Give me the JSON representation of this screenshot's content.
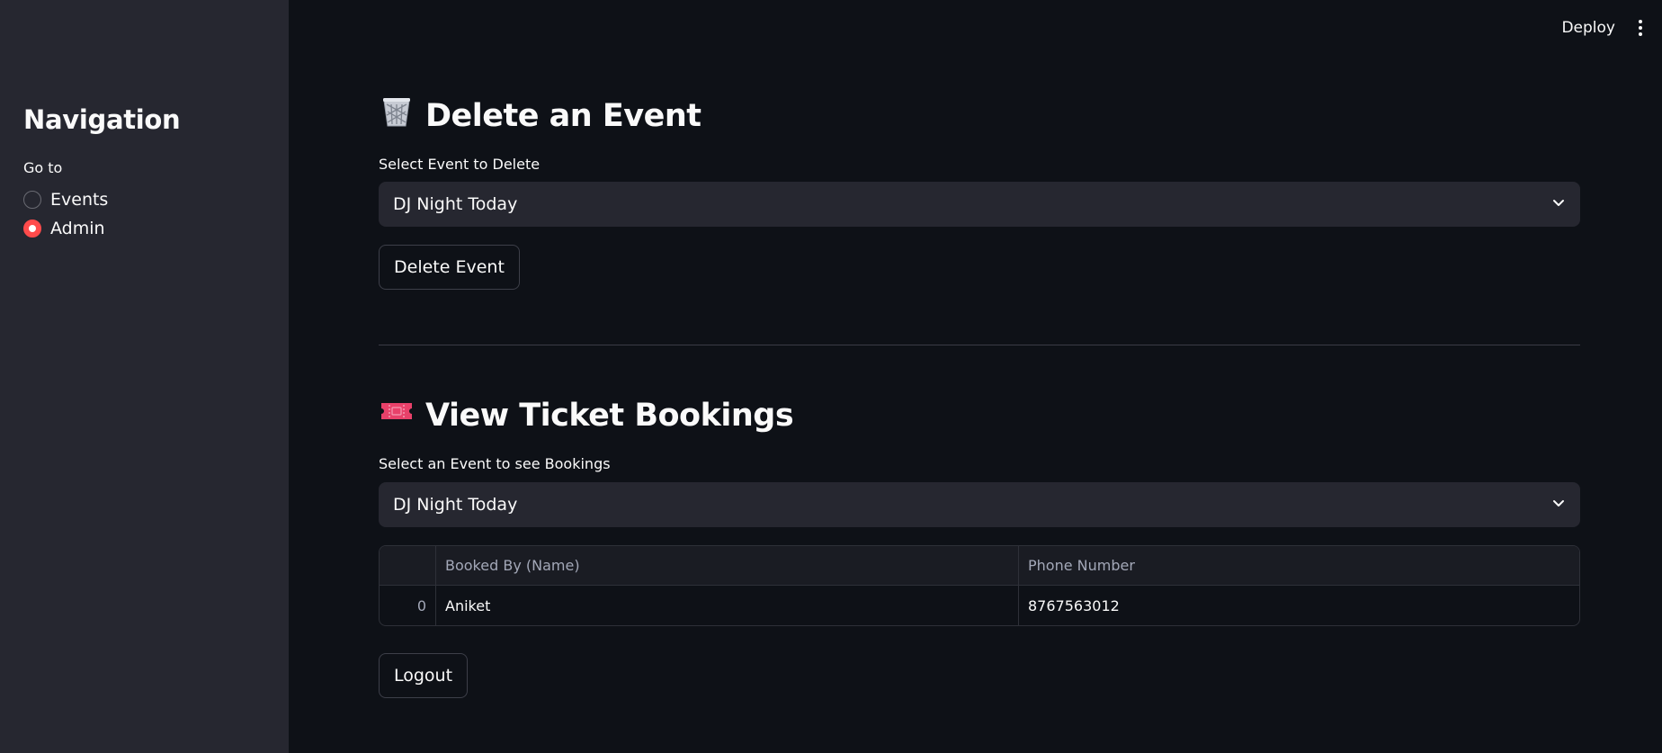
{
  "header": {
    "deploy_label": "Deploy"
  },
  "sidebar": {
    "title": "Navigation",
    "goto_label": "Go to",
    "options": [
      {
        "label": "Events",
        "selected": false
      },
      {
        "label": "Admin",
        "selected": true
      }
    ]
  },
  "delete_section": {
    "icon": "wastebasket-icon",
    "title": "Delete an Event",
    "select_label": "Select Event to Delete",
    "select_value": "DJ Night Today",
    "button_label": "Delete Event"
  },
  "bookings_section": {
    "icon": "ticket-icon",
    "title": "View Ticket Bookings",
    "select_label": "Select an Event to see Bookings",
    "select_value": "DJ Night Today",
    "table": {
      "columns": [
        "",
        "Booked By (Name)",
        "Phone Number"
      ],
      "rows": [
        {
          "index": "0",
          "name": "Aniket",
          "phone": "8767563012"
        }
      ]
    }
  },
  "logout_label": "Logout",
  "colors": {
    "accent": "#ff4b4b",
    "background": "#0e1117",
    "sidebar": "#262730",
    "ticket": "#e8416a"
  }
}
